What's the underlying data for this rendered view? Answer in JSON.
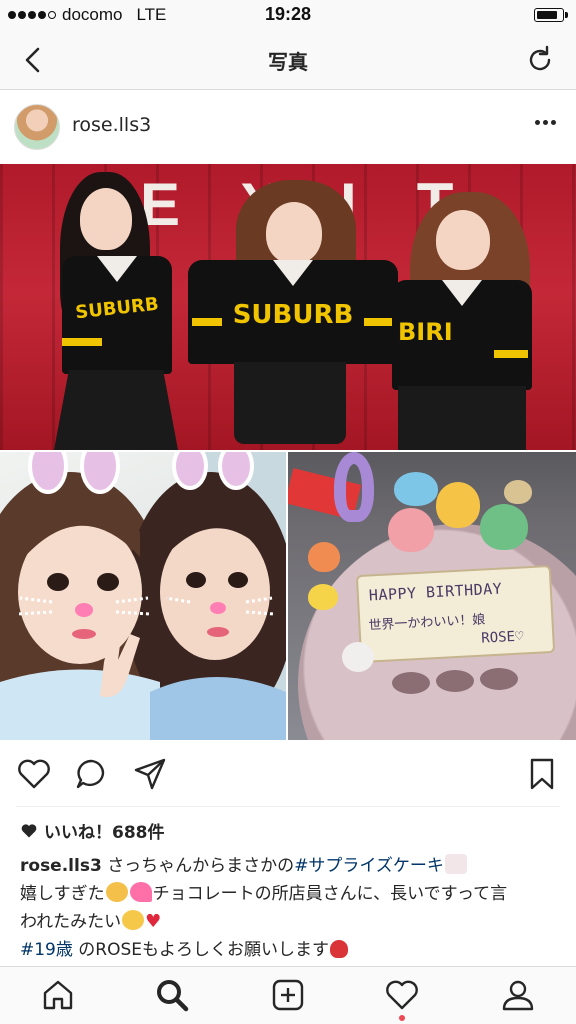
{
  "status_bar": {
    "carrier": "docomo",
    "network": "LTE",
    "time": "19:28",
    "battery_level": 0.9
  },
  "nav": {
    "title": "写真",
    "back_icon": "chevron-left-icon",
    "refresh_icon": "refresh-icon"
  },
  "post": {
    "username": "rose.lls3",
    "image": {
      "top_sign": "EXIT",
      "jersey_logo": "SUBURB",
      "cake_plaque": {
        "line1": "HAPPY BIRTHDAY",
        "line2": "世界一かわいい！娘",
        "line3": "ROSE♡"
      }
    },
    "likes": "いいね！688件",
    "caption": {
      "username": "rose.lls3",
      "text_part1": "さっちゃんからまさかの",
      "hashtag1": "#サプライズケーキ",
      "line2_text_a": "嬉しすぎた",
      "line2_text_b": "チョコレートの所店員さんに、長いですって言",
      "line3_text": "われたみたい",
      "hashtag2": "#19歳",
      "line4_text": " のROSEもよろしくお願いします"
    }
  },
  "actions": {
    "like_icon": "heart-icon",
    "comment_icon": "comment-icon",
    "share_icon": "share-icon",
    "save_icon": "bookmark-icon"
  },
  "tabs": [
    {
      "icon": "home-icon"
    },
    {
      "icon": "search-icon",
      "active": true
    },
    {
      "icon": "add-icon"
    },
    {
      "icon": "heart-icon",
      "notification": true
    },
    {
      "icon": "profile-icon"
    }
  ],
  "colors": {
    "hashtag": "#003569",
    "notification": "#ed4956",
    "jersey_yellow": "#f1c400",
    "wall_red": "#b01a2a"
  }
}
